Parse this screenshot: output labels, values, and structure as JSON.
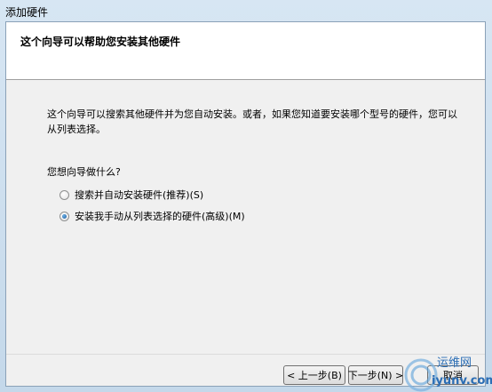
{
  "window": {
    "title": "添加硬件"
  },
  "header": {
    "title": "这个向导可以帮助您安装其他硬件"
  },
  "main": {
    "description": "这个向导可以搜索其他硬件并为您自动安装。或者，如果您知道要安装哪个型号的硬件，您可以从列表选择。",
    "question": "您想向导做什么?",
    "options": [
      {
        "label": "搜索并自动安装硬件(推荐)(S)",
        "checked": false
      },
      {
        "label": "安装我手动从列表选择的硬件(高级)(M)",
        "checked": true
      }
    ]
  },
  "buttons": {
    "back": "< 上一步(B)",
    "next": "下一步(N) >",
    "cancel": "取消"
  },
  "watermark": {
    "text_cn": "运维网",
    "text_en": "iyunv.com"
  }
}
